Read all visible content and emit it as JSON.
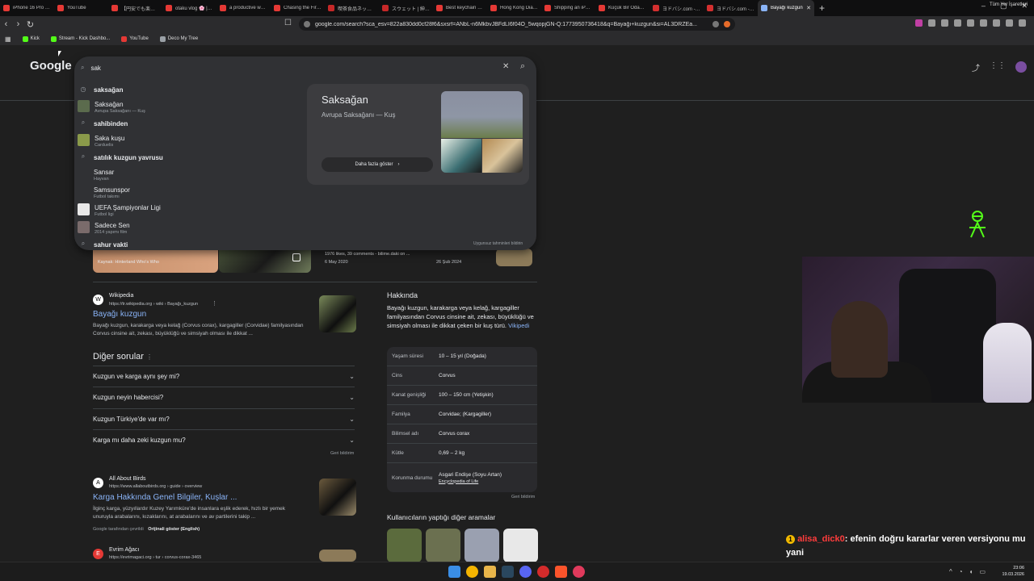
{
  "tabs": [
    {
      "label": "iPhone 16 Pro (Mac",
      "color": "#e53935"
    },
    {
      "label": "YouTube",
      "color": "#e53935"
    },
    {
      "label": "【円安でも楽しめる",
      "color": "#e53935"
    },
    {
      "label": "otaku vlog 🌸 | spr",
      "color": "#e53935"
    },
    {
      "label": "a productive week",
      "color": "#e53935"
    },
    {
      "label": "Chasing the First Su",
      "color": "#e53935"
    },
    {
      "label": "喫茶食品ネットストア",
      "color": "#c62828"
    },
    {
      "label": "スウェット | 紳士・メン",
      "color": "#c62828"
    },
    {
      "label": "Best keychain mult",
      "color": "#e53935"
    },
    {
      "label": "Hong Kong Diaries",
      "color": "#e53935"
    },
    {
      "label": "Shipping an iPhone",
      "color": "#e53935"
    },
    {
      "label": "Küçük Bir Odayı Sa",
      "color": "#e53935"
    },
    {
      "label": "ヨドバシ.com - 2ページ",
      "color": "#d32f2f"
    },
    {
      "label": "ヨドバシ.com - dyso",
      "color": "#d32f2f"
    },
    {
      "label": "Bayağı kuzgun",
      "color": "#8ab4f8",
      "active": true
    }
  ],
  "window_controls": [
    "–",
    "▢",
    "✕"
  ],
  "nav": {
    "back": "‹",
    "forward": "›",
    "reload": "↻"
  },
  "omnibox": {
    "url": "google.com/search?sca_esv=822a830dd0cf28f6&sxsrf=ANbL-n6MkbvJBFdLI6f04O_5wqopjGN-Q:1773950736418&q=Bayağı+kuzgun&si=AL3DRZEa..."
  },
  "bookmarks": [
    {
      "label": "Kick",
      "color": "#53fc18"
    },
    {
      "label": "Stream - Kick Dashbo...",
      "color": "#53fc18"
    },
    {
      "label": "YouTube",
      "color": "#e53935"
    },
    {
      "label": "Deco My Tree",
      "color": "#9aa0a6"
    }
  ],
  "bookmarks_right": "Tüm Yer İşaretleri",
  "google": {
    "logo": "Google",
    "search_value": "sak",
    "suggestions": [
      {
        "title": "saksağan",
        "sub": "",
        "icon": "history-icon",
        "bold": true
      },
      {
        "title": "Saksağan",
        "sub": "Avrupa Saksağanı — Kuş",
        "thumb": "#5b6b4d"
      },
      {
        "title": "sahibinden",
        "sub": "",
        "icon": "search-icon",
        "bold": true
      },
      {
        "title": "Saka kuşu",
        "sub": "Carduelis",
        "thumb": "#8a9a4a"
      },
      {
        "title": "satılık kuzgun yavrusu",
        "sub": "",
        "icon": "search-icon",
        "bold": true
      },
      {
        "title": "Sansar",
        "sub": "Hayvan",
        "icon": "none"
      },
      {
        "title": "Samsunspor",
        "sub": "Futbol takımı",
        "icon": "none"
      },
      {
        "title": "UEFA Şampiyonlar Ligi",
        "sub": "Futbol ligi",
        "thumb": "#e8e8e8"
      },
      {
        "title": "Sadece Sen",
        "sub": "2014 yapımı film",
        "thumb": "#7a6b6b"
      },
      {
        "title": "sahur vakti",
        "sub": "",
        "icon": "search-icon",
        "bold": true
      }
    ],
    "kp_card": {
      "title": "Saksağan",
      "subtitle": "Avrupa Saksağanı — Kuş",
      "button": "Daha fazla göster",
      "arrow": "›"
    },
    "report_text": "Uygunsuz tahminleri bildirin",
    "image_tiles": [
      {
        "caption": "Kaynak: Hinterland Who's Who"
      },
      {
        "caption": "1976 likes, 39 comments - bilime.daki on ...",
        "sub": "6 May 2020"
      },
      {
        "caption": "",
        "sub": "26 Şub 2024"
      }
    ],
    "results": [
      {
        "site": "Wikipedia",
        "url": "https://tr.wikipedia.org › wiki › Bayağı_kuzgun",
        "title": "Bayağı kuzgun",
        "snippet": "Bayağı kuzgun, karakarga veya kelağ (Corvus corax), kargagiller (Corvidae) familyasından Corvus cinsine ait, zekası, büyüklüğü ve simsiyah olması ile dikkat ...",
        "fav": "W"
      },
      {
        "site": "All About Birds",
        "url": "https://www.allaboutbirds.org › guide › overview",
        "title": "Karga Hakkında Genel Bilgiler, Kuşlar ...",
        "snippet": "İlginç karga, yüzyıllardır Kuzey Yarımküre'de insanlara eşlik ederek, hızlı bir yemek unuruyla arabalarını, kızaklarını, at arabalarını ve av partilerini takip ...",
        "fav": "A",
        "translated": "Google tarafından çevrildi",
        "original": "Orijinali göster (English)"
      },
      {
        "site": "Evrim Ağacı",
        "url": "https://evrimagaci.org › tur › corvus-corax-3465",
        "fav": "E"
      }
    ],
    "paa": {
      "title": "Diğer sorular",
      "questions": [
        "Kuzgun ve karga aynı şey mi?",
        "Kuzgun neyin habercisi?",
        "Kuzgun Türkiye'de var mı?",
        "Karga mı daha zeki kuzgun mu?"
      ],
      "feedback": "Geri bildirim"
    },
    "about": {
      "title": "Hakkında",
      "desc": "Bayağı kuzgun, karakarga veya kelağ, kargagiller familyasından Corvus cinsine ait, zekası, büyüklüğü ve simsiyah olması ile dikkat çeken bir kuş türü.",
      "wiki": "Vikipedi",
      "facts": [
        {
          "k": "Yaşam süresi",
          "v": "10 – 15 yıl (Doğada)"
        },
        {
          "k": "Cins",
          "v": "Corvus"
        },
        {
          "k": "Kanat genişliği",
          "v": "100 – 150 cm (Yetişkin)"
        },
        {
          "k": "Familya",
          "v": "Corvidae; (Kargagiller)"
        },
        {
          "k": "Bilimsel adı",
          "v": "Corvus corax"
        },
        {
          "k": "Kütle",
          "v": "0,69 – 2 kg"
        },
        {
          "k": "Korunma durumu",
          "v": "Asgari Endişe (Soyu Artan)",
          "link": "Encyclopedia of Life"
        }
      ],
      "feedback": "Geri bildirim",
      "others_title": "Kullanıcıların yaptığı diğer aramalar"
    }
  },
  "chat": {
    "badge": "1",
    "user": "alisa_dick0",
    "message": ": efenin doğru kararlar veren versiyonu mu yani"
  },
  "clock": {
    "time": "23:06",
    "date": "19.03.2026"
  }
}
